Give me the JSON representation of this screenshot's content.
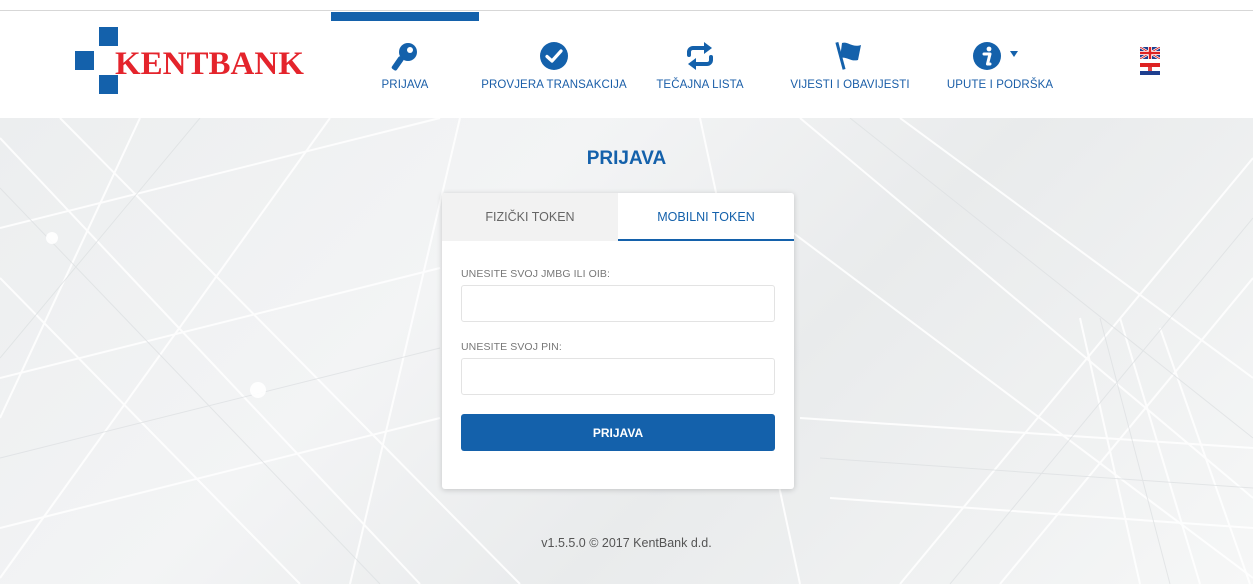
{
  "brand": {
    "name": "KENTBANK",
    "color_primary": "#1461ab",
    "color_logo_text": "#e4242c"
  },
  "nav": {
    "items": [
      {
        "label": "PRIJAVA",
        "icon": "key-icon",
        "active": true
      },
      {
        "label": "PROVJERA TRANSAKCIJA",
        "icon": "check-circle-icon",
        "active": false
      },
      {
        "label": "TEČAJNA LISTA",
        "icon": "exchange-arrows-icon",
        "active": false
      },
      {
        "label": "VIJESTI I OBAVIJESTI",
        "icon": "flag-icon",
        "active": false
      },
      {
        "label": "UPUTE I PODRŠKA",
        "icon": "info-icon",
        "active": false,
        "has_dropdown": true
      }
    ],
    "languages": [
      {
        "code": "en",
        "icon": "uk-flag-icon"
      },
      {
        "code": "hr",
        "icon": "croatia-flag-icon"
      }
    ]
  },
  "login": {
    "title": "PRIJAVA",
    "tabs": [
      {
        "label": "FIZIČKI TOKEN",
        "active": false
      },
      {
        "label": "MOBILNI TOKEN",
        "active": true
      }
    ],
    "id_label": "UNESITE SVOJ JMBG ILI OIB:",
    "id_value": "",
    "pin_label": "UNESITE SVOJ PIN:",
    "pin_value": "",
    "submit_label": "PRIJAVA"
  },
  "footer": {
    "text": "v1.5.5.0 © 2017 KentBank d.d."
  }
}
